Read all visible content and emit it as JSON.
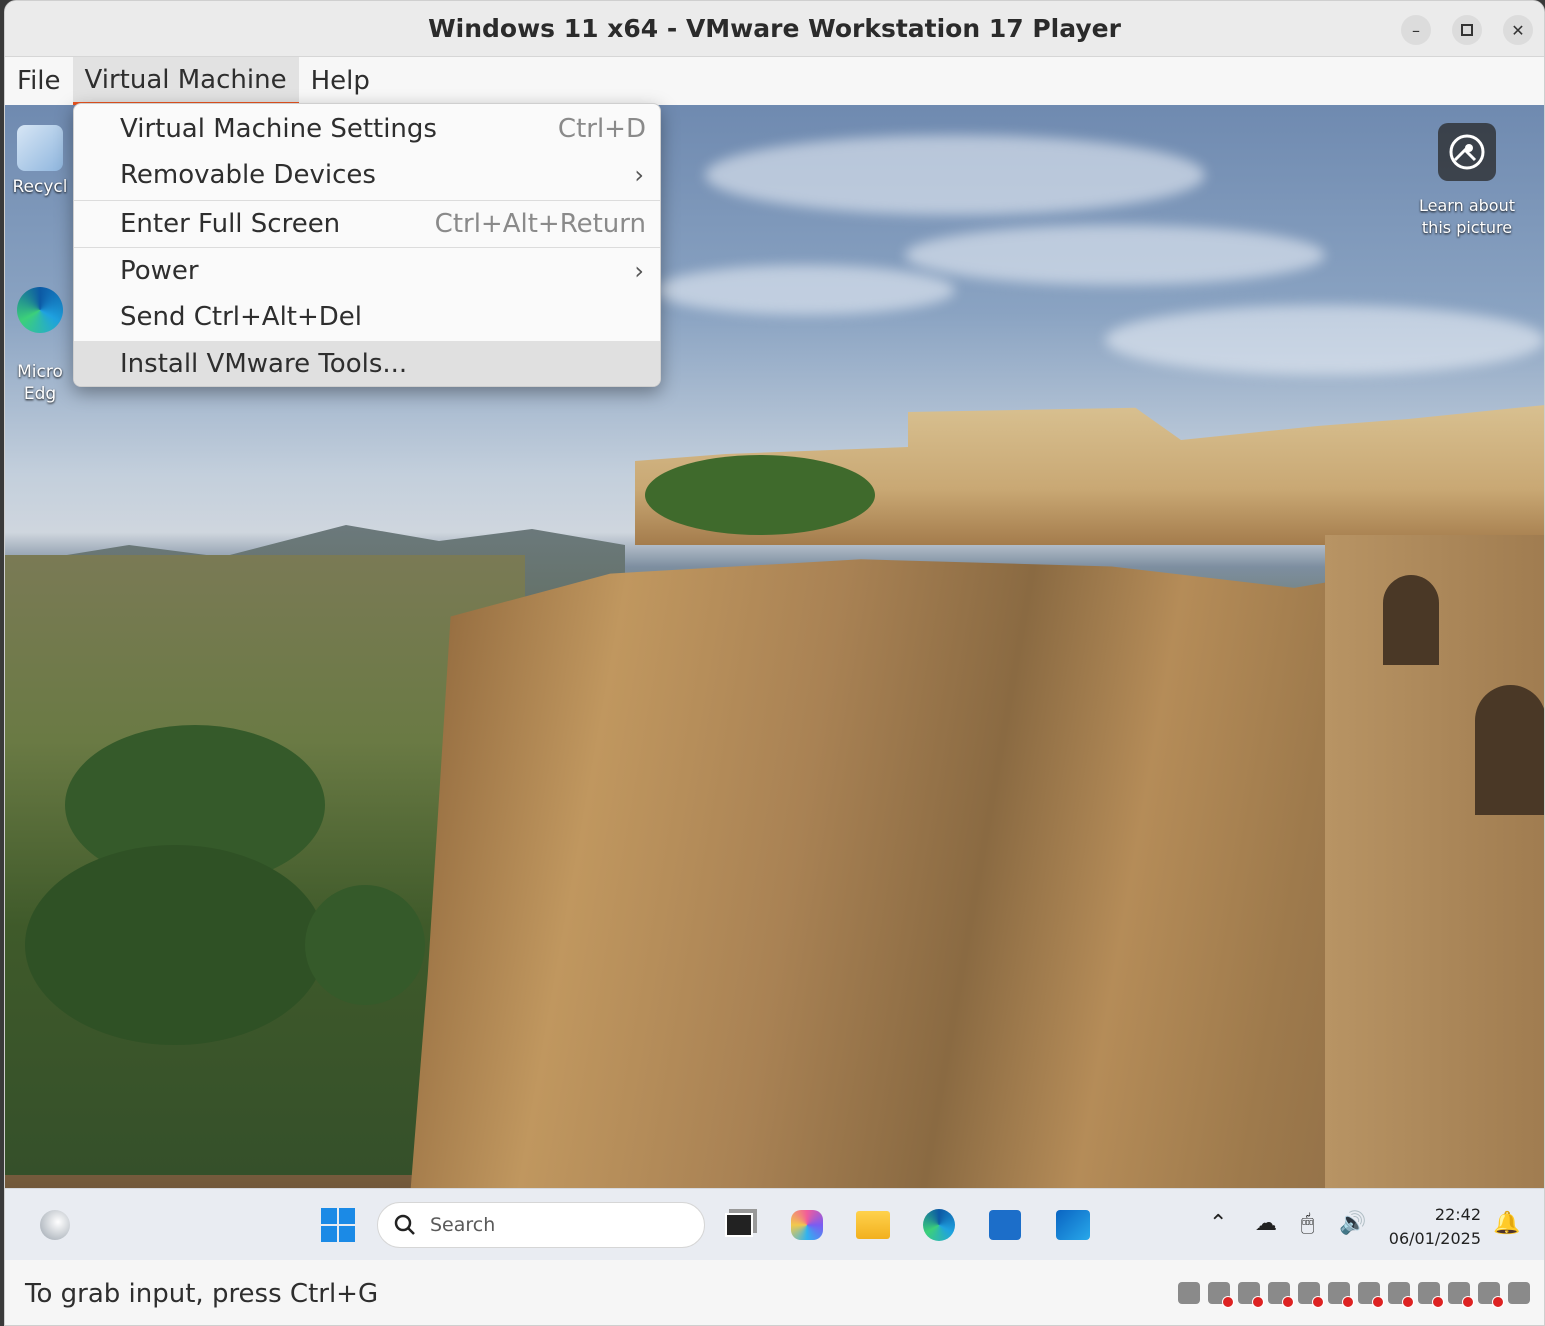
{
  "window": {
    "title": "Windows 11 x64 - VMware Workstation 17 Player",
    "minimize_icon": "minimize-icon",
    "maximize_icon": "maximize-icon",
    "close_icon": "close-icon"
  },
  "menubar": {
    "items": [
      {
        "label": "File"
      },
      {
        "label": "Virtual Machine",
        "active": true
      },
      {
        "label": "Help"
      }
    ]
  },
  "dropdown": {
    "items": [
      {
        "label": "Virtual Machine Settings",
        "shortcut": "Ctrl+D"
      },
      {
        "label": "Removable Devices",
        "submenu": "›"
      },
      {
        "label": "Enter Full Screen",
        "shortcut": "Ctrl+Alt+Return"
      },
      {
        "label": "Power",
        "submenu": "›"
      },
      {
        "label": "Send Ctrl+Alt+Del"
      },
      {
        "label": "Install VMware Tools...",
        "highlighted": true
      }
    ]
  },
  "desktop": {
    "icons": [
      {
        "label": "Recycl",
        "icon": "recycle-bin-icon"
      },
      {
        "label": "Micro\nEdg",
        "icon": "edge-icon"
      }
    ],
    "learn_about": {
      "line1": "Learn about",
      "line2": "this picture",
      "icon": "camera-icon"
    }
  },
  "taskbar": {
    "search_placeholder": "Search",
    "time": "22:42",
    "date": "06/01/2025"
  },
  "statusbar": {
    "text": "To grab input, press Ctrl+G"
  },
  "colors": {
    "accent": "#e95420",
    "menu_bg": "#fafafa",
    "highlight": "#e0e0e0"
  }
}
